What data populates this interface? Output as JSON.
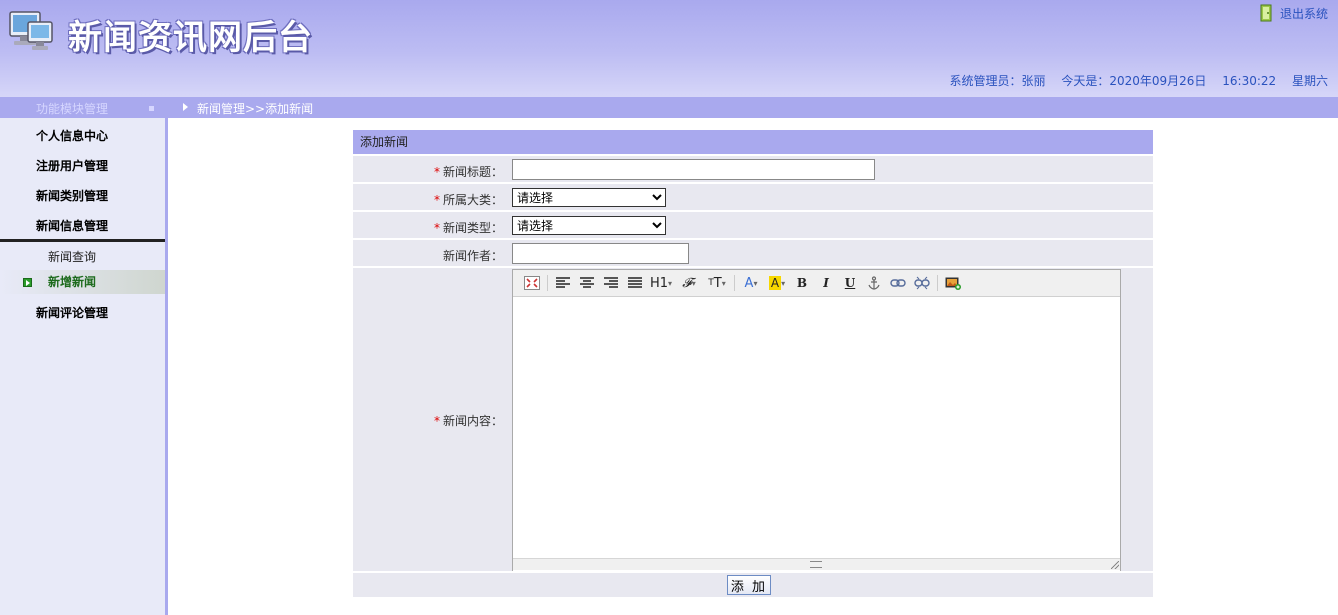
{
  "header": {
    "title": "新闻资讯网后台",
    "logout_label": "退出系统",
    "admin_text": "系统管理员：张丽",
    "date_text": "今天是：2020年09月26日",
    "time_text": "16:30:22",
    "weekday_text": "星期六"
  },
  "nav": {
    "module_title": "功能模块管理",
    "breadcrumb": "新闻管理>>添加新闻"
  },
  "sidebar": {
    "items": [
      {
        "label": "个人信息中心"
      },
      {
        "label": "注册用户管理"
      },
      {
        "label": "新闻类别管理"
      },
      {
        "label": "新闻信息管理"
      },
      {
        "label": "新闻评论管理"
      }
    ],
    "subitems": [
      {
        "label": "新闻查询"
      },
      {
        "label": "新增新闻"
      }
    ]
  },
  "form": {
    "header": "添加新闻",
    "required_mark": "*",
    "title_label": "新闻标题：",
    "title_value": "",
    "category_label": "所属大类：",
    "category_selected": "请选择",
    "type_label": "新闻类型：",
    "type_selected": "请选择",
    "author_label": "新闻作者：",
    "author_value": "",
    "content_label": "新闻内容：",
    "submit_label": "添 加"
  },
  "editor": {
    "toolbar_icons": [
      "fullscreen-icon",
      "align-left-icon",
      "align-center-icon",
      "align-right-icon",
      "align-justify-icon",
      "heading-icon",
      "font-family-icon",
      "font-size-icon",
      "font-color-icon",
      "highlight-color-icon",
      "bold-icon",
      "italic-icon",
      "underline-icon",
      "anchor-icon",
      "link-icon",
      "unlink-icon",
      "insert-image-icon"
    ],
    "heading_text": "H1",
    "bold_text": "B",
    "italic_text": "I",
    "underline_text": "U",
    "fontcolor_text": "A",
    "highlight_text": "A"
  },
  "colors": {
    "header_bg": "#a9a9ee",
    "link_blue": "#2a52be",
    "required_red": "#dd0000",
    "sidebar_bg": "#e8eaf8",
    "active_green": "#1d6b1d"
  }
}
